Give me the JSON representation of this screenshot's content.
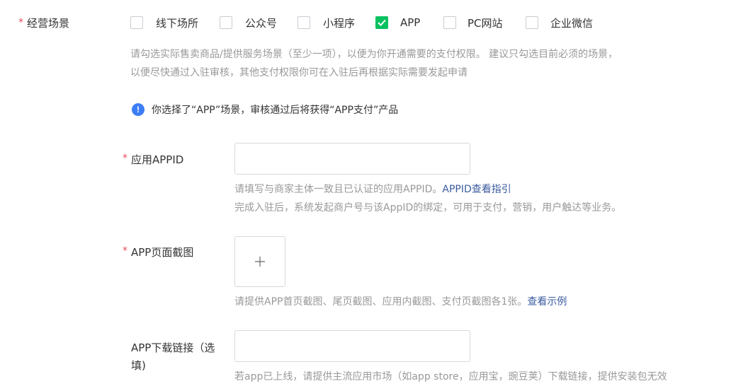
{
  "scene": {
    "required_mark": "*",
    "label": "经营场景",
    "options": [
      {
        "label": "线下场所",
        "checked": false
      },
      {
        "label": "公众号",
        "checked": false
      },
      {
        "label": "小程序",
        "checked": false
      },
      {
        "label": "APP",
        "checked": true
      },
      {
        "label": "PC网站",
        "checked": false
      },
      {
        "label": "企业微信",
        "checked": false
      }
    ],
    "hint_line1": "请勾选实际售卖商品/提供服务场景（至少一项），以便为你开通需要的支付权限。 建议只勾选目前必须的场景，",
    "hint_line2": "以便尽快通过入驻审核，其他支付权限你可在入驻后再根据实际需要发起申请",
    "notice": "你选择了“APP”场景，审核通过后将获得“APP支付”产品",
    "notice_icon": "!"
  },
  "appid": {
    "required_mark": "*",
    "label": "应用APPID",
    "value": "",
    "hint_line1": "请填写与商家主体一致且已认证的应用APPID。",
    "hint_link": "APPID查看指引",
    "hint_line2": "完成入驻后，系统发起商户号与该AppID的绑定，可用于支付，营销，用户触达等业务。"
  },
  "screenshot": {
    "required_mark": "*",
    "label": "APP页面截图",
    "plus": "+",
    "hint": "请提供APP首页截图、尾页截图、应用内截图、支付页截图各1张。",
    "hint_link": "查看示例"
  },
  "download": {
    "label_line1": "APP下载链接（选",
    "label_line2": "填)",
    "value": "",
    "hint": "若app已上线，请提供主流应用市场（如app store，应用宝，豌豆荚）下载链接，提供安装包无效"
  },
  "colors": {
    "check": "#07c160",
    "link": "#3a5b9f",
    "required": "#e34d59",
    "info": "#3d7ef6"
  }
}
